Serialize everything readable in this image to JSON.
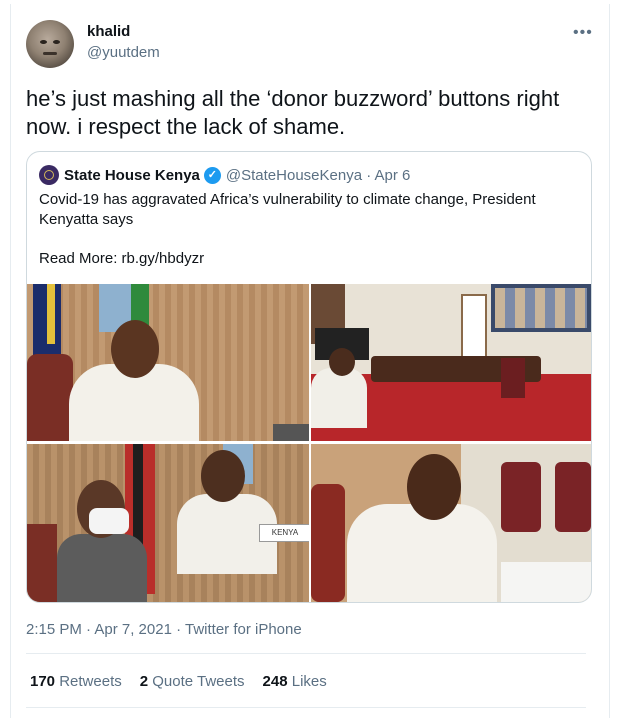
{
  "tweet": {
    "author_name": "khalid",
    "author_handle": "@yuutdem",
    "more_icon": "more-icon",
    "text": "he’s just mashing all the ‘donor buzzword’ buttons right now. i respect the lack of shame.",
    "timestamp": "2:15 PM · Apr 7, 2021 · Twitter for iPhone"
  },
  "quote": {
    "author_name": "State House Kenya",
    "verified_icon": "verified-badge-icon",
    "handle_date": "@StateHouseKenya · Apr 6",
    "text": "Covid-19 has aggravated Africa’s vulnerability to climate change, President Kenyatta says",
    "read_more": "Read More: rb.gy/hbdyzr",
    "photo_sign": "KENYA"
  },
  "stats": {
    "retweets_count": "170",
    "retweets_label": "Retweets",
    "quotes_count": "2",
    "quotes_label": "Quote Tweets",
    "likes_count": "248",
    "likes_label": "Likes"
  },
  "colors": {
    "text": "#0f1419",
    "secondary": "#5b7083",
    "verified": "#1d9bf0",
    "border": "#cfd9de"
  }
}
